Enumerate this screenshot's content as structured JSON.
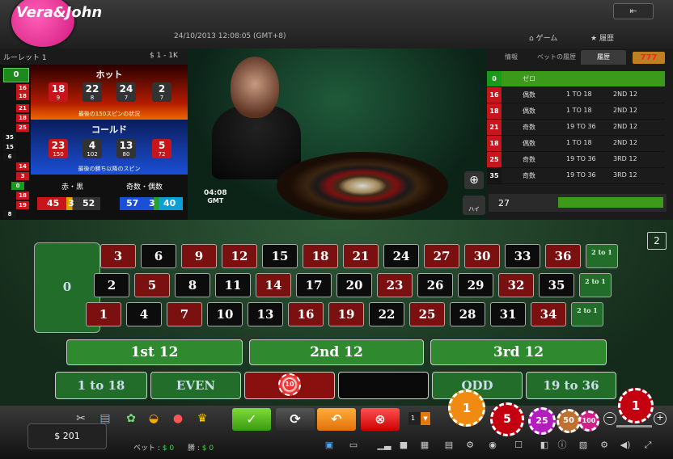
{
  "header": {
    "logo_text": "Vera&John",
    "timestamp": "24/10/2013 12:08:05 (GMT+8)",
    "exit_icon": "exit-icon",
    "nav_game": "ゲーム",
    "nav_history": "履歴"
  },
  "left_panel": {
    "table_name": "ルーレット 1",
    "limits": "$ 1 - 1K",
    "zero": "0",
    "recent_results": [
      "16",
      "18",
      "21",
      "18",
      "25",
      "35",
      "15",
      "6",
      "14",
      "3",
      "0",
      "18",
      "19",
      "8"
    ],
    "hot": {
      "title": "ホット",
      "numbers": [
        {
          "n": "18",
          "c": "9"
        },
        {
          "n": "22",
          "c": "8"
        },
        {
          "n": "24",
          "c": "7"
        },
        {
          "n": "2",
          "c": "7"
        }
      ],
      "caption": "最後の150スピンの状況"
    },
    "cold": {
      "title": "コールド",
      "numbers": [
        {
          "n": "23",
          "c": "150"
        },
        {
          "n": "4",
          "c": "102"
        },
        {
          "n": "13",
          "c": "80"
        },
        {
          "n": "5",
          "c": "72"
        }
      ],
      "caption": "最後の勝ち以降のスピン"
    },
    "red_black": {
      "label": "赤・黒",
      "red": "45",
      "zero": "3",
      "black": "52"
    },
    "odd_even": {
      "label": "奇数・偶数",
      "odd": "57",
      "zero": "3",
      "even": "40"
    }
  },
  "video": {
    "time": "04:08",
    "tz": "GMT",
    "zoom_icon": "zoom-in-icon",
    "hi_label": "ハイ"
  },
  "right_panel": {
    "tabs": [
      "情報",
      "ベットの履歴",
      "履歴"
    ],
    "tab_777": "777",
    "rows": [
      {
        "n": "0",
        "color": "green",
        "a": "ゼロ",
        "b": "",
        "c": ""
      },
      {
        "n": "16",
        "color": "red",
        "a": "偶数",
        "b": "1 TO 18",
        "c": "2ND 12"
      },
      {
        "n": "18",
        "color": "red",
        "a": "偶数",
        "b": "1 TO 18",
        "c": "2ND 12"
      },
      {
        "n": "21",
        "color": "red",
        "a": "奇数",
        "b": "19 TO 36",
        "c": "2ND 12"
      },
      {
        "n": "18",
        "color": "red",
        "a": "偶数",
        "b": "1 TO 18",
        "c": "2ND 12"
      },
      {
        "n": "25",
        "color": "red",
        "a": "奇数",
        "b": "19 TO 36",
        "c": "3RD 12"
      },
      {
        "n": "35",
        "color": "black",
        "a": "奇数",
        "b": "19 TO 36",
        "c": "3RD 12"
      }
    ],
    "stat_value": "27"
  },
  "table": {
    "zero": "0",
    "page_badge": "2",
    "rows": [
      [
        "3",
        "6",
        "9",
        "12",
        "15",
        "18",
        "21",
        "24",
        "27",
        "30",
        "33",
        "36"
      ],
      [
        "2",
        "5",
        "8",
        "11",
        "14",
        "17",
        "20",
        "23",
        "26",
        "29",
        "32",
        "35"
      ],
      [
        "1",
        "4",
        "7",
        "10",
        "13",
        "16",
        "19",
        "22",
        "25",
        "28",
        "31",
        "34"
      ]
    ],
    "row_colors": [
      [
        "r",
        "b",
        "r",
        "r",
        "b",
        "r",
        "r",
        "b",
        "r",
        "r",
        "b",
        "r"
      ],
      [
        "b",
        "r",
        "b",
        "b",
        "r",
        "b",
        "b",
        "r",
        "b",
        "b",
        "r",
        "b"
      ],
      [
        "r",
        "b",
        "r",
        "b",
        "b",
        "r",
        "r",
        "b",
        "r",
        "b",
        "b",
        "r"
      ]
    ],
    "column_bet": "2 to 1",
    "dozens": [
      "1st 12",
      "2nd 12",
      "3rd 12"
    ],
    "outside": [
      "1 to 18",
      "EVEN",
      "",
      "",
      "ODD",
      "19 to 36"
    ],
    "chip_on_red": "10"
  },
  "bottom": {
    "balance": "$ 201",
    "bet_label": "ベット :",
    "bet_value": "$ 0",
    "win_label": "勝 :",
    "win_value": "$ 0",
    "multiplier": "1",
    "chips": [
      "1",
      "5",
      "25",
      "50",
      "100"
    ],
    "selected_chip": "1"
  }
}
